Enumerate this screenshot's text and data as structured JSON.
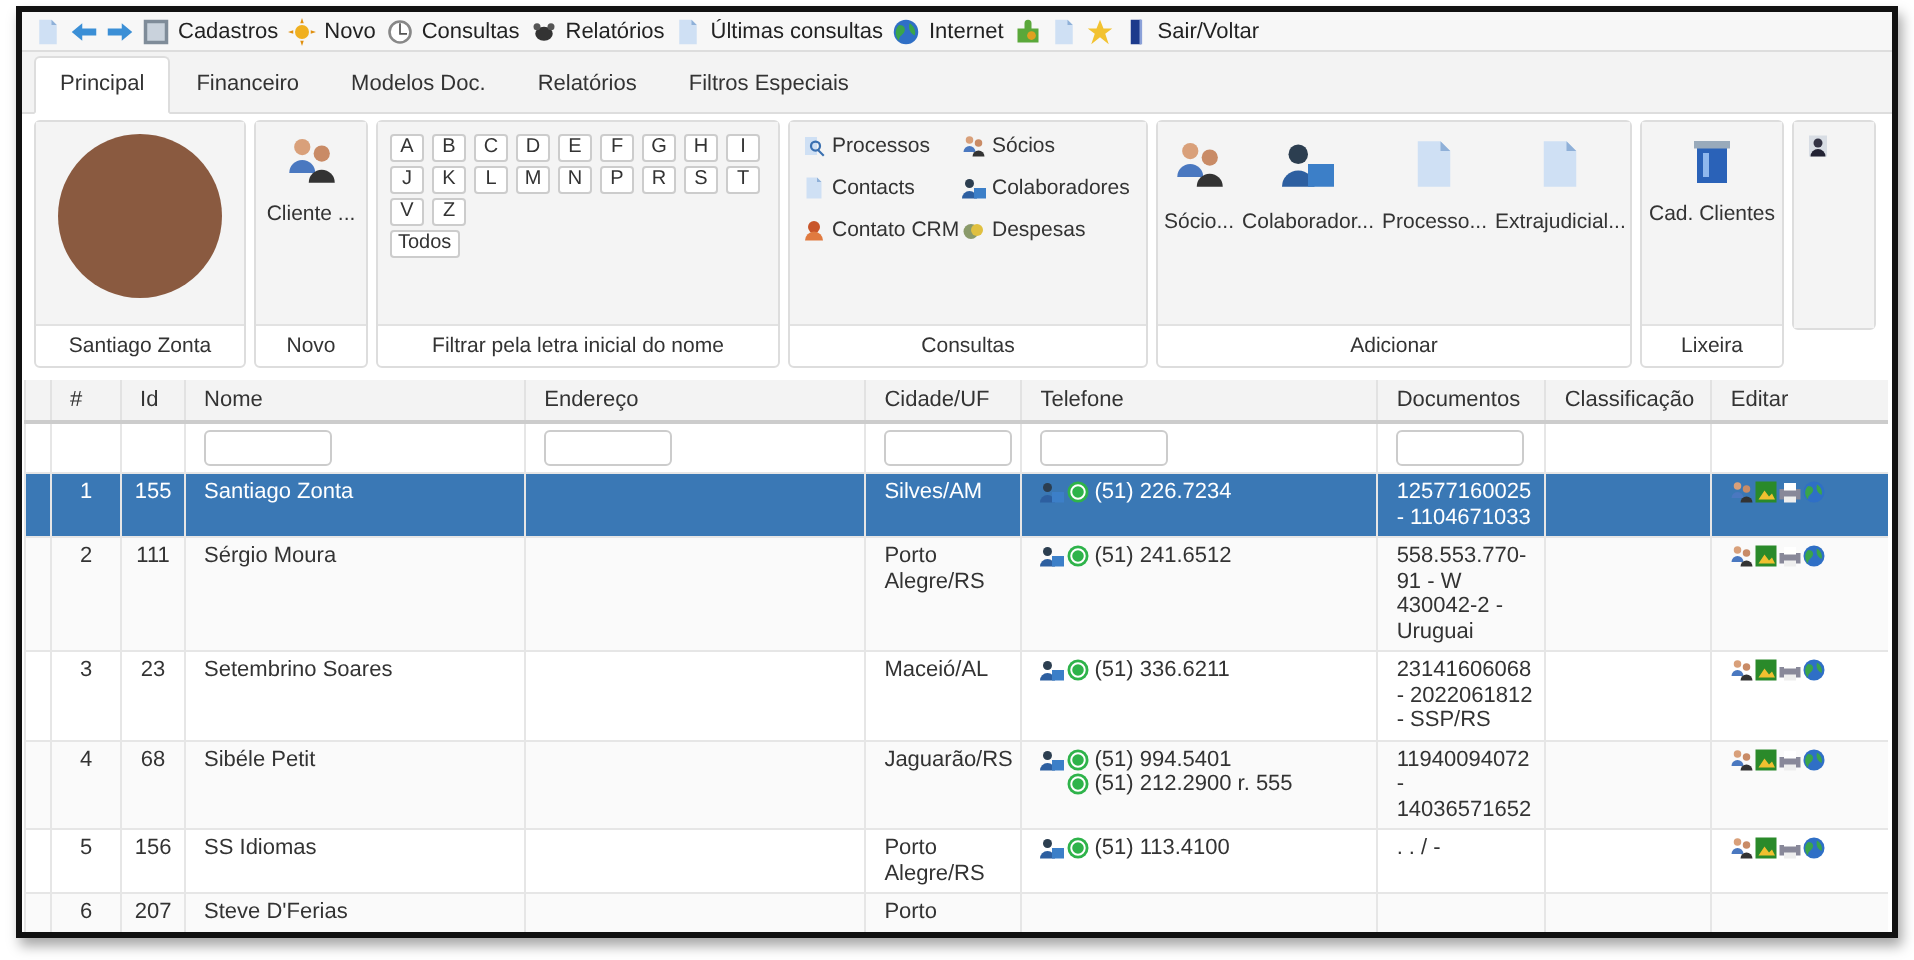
{
  "toolbar": {
    "items": [
      {
        "label": "Cadastros"
      },
      {
        "label": "Novo"
      },
      {
        "label": "Consultas"
      },
      {
        "label": "Relatórios"
      },
      {
        "label": "Últimas consultas"
      },
      {
        "label": "Internet"
      },
      {
        "label": "Sair/Voltar"
      }
    ]
  },
  "tabs": [
    {
      "label": "Principal",
      "selected": true
    },
    {
      "label": "Financeiro",
      "selected": false
    },
    {
      "label": "Modelos Doc.",
      "selected": false
    },
    {
      "label": "Relatórios",
      "selected": false
    },
    {
      "label": "Filtros Especiais",
      "selected": false
    }
  ],
  "ribbon": {
    "profile": {
      "name": "Santiago Zonta"
    },
    "novo": {
      "button": "Cliente ...",
      "caption": "Novo"
    },
    "letters": {
      "buttons": [
        "A",
        "B",
        "C",
        "D",
        "E",
        "F",
        "G",
        "H",
        "I",
        "J",
        "K",
        "L",
        "M",
        "N",
        "P",
        "R",
        "S",
        "T",
        "V",
        "Z"
      ],
      "all": "Todos",
      "caption": "Filtrar pela letra inicial do nome"
    },
    "consultas": {
      "links": [
        "Processos",
        "Sócios",
        "Contacts",
        "Colaboradores",
        "Contato CRM",
        "Despesas"
      ],
      "caption": "Consultas"
    },
    "adicionar": {
      "buttons": [
        "Sócio...",
        "Colaborador...",
        "Processo...",
        "Extrajudicial..."
      ],
      "caption": "Adicionar"
    },
    "lixeira": {
      "button": "Cad. Clientes",
      "caption": "Lixeira"
    }
  },
  "table": {
    "columns": [
      {
        "label": "#",
        "filter": false
      },
      {
        "label": "Id",
        "filter": false
      },
      {
        "label": "Nome",
        "filter": true
      },
      {
        "label": "Endereço",
        "filter": true
      },
      {
        "label": "Cidade/UF",
        "filter": true
      },
      {
        "label": "Telefone",
        "filter": true
      },
      {
        "label": "Documentos",
        "filter": true
      },
      {
        "label": "Classificação",
        "filter": false
      },
      {
        "label": "Editar",
        "filter": false
      }
    ],
    "rows": [
      {
        "n": "1",
        "id": "155",
        "name": "Santiago  Zonta",
        "city": "Silves/AM",
        "phones": [
          {
            "number": "(51)  226.7234",
            "contact": true
          }
        ],
        "documents": "12577160025  -  1104671033",
        "selected": true
      },
      {
        "n": "2",
        "id": "111",
        "name": "Sérgio  Moura",
        "city": "Porto Alegre/RS",
        "phones": [
          {
            "number": "(51)  241.6512",
            "contact": true
          }
        ],
        "documents": "558.553.770-91  -  W 430042-2  -  Uruguai",
        "selected": false
      },
      {
        "n": "3",
        "id": "23",
        "name": "Setembrino  Soares",
        "city": "Maceió/AL",
        "phones": [
          {
            "number": "(51)  336.6211",
            "contact": true
          }
        ],
        "documents": "23141606068  -  2022061812  -  SSP/RS",
        "selected": false
      },
      {
        "n": "4",
        "id": "68",
        "name": "Sibéle  Petit",
        "city": "Jaguarão/RS",
        "phones": [
          {
            "number": "(51)  994.5401",
            "contact": true
          },
          {
            "number": "(51)  212.2900  r.  555",
            "contact": false
          }
        ],
        "documents": "11940094072 - 14036571652",
        "selected": false
      },
      {
        "n": "5",
        "id": "156",
        "name": "SS  Idiomas",
        "city": "Porto Alegre/RS",
        "phones": [
          {
            "number": "(51)  113.4100",
            "contact": true
          }
        ],
        "documents": ". . / -",
        "selected": false
      },
      {
        "n": "6",
        "id": "207",
        "name": "Steve  D'Ferias",
        "city": "Porto",
        "selected": false
      }
    ]
  }
}
